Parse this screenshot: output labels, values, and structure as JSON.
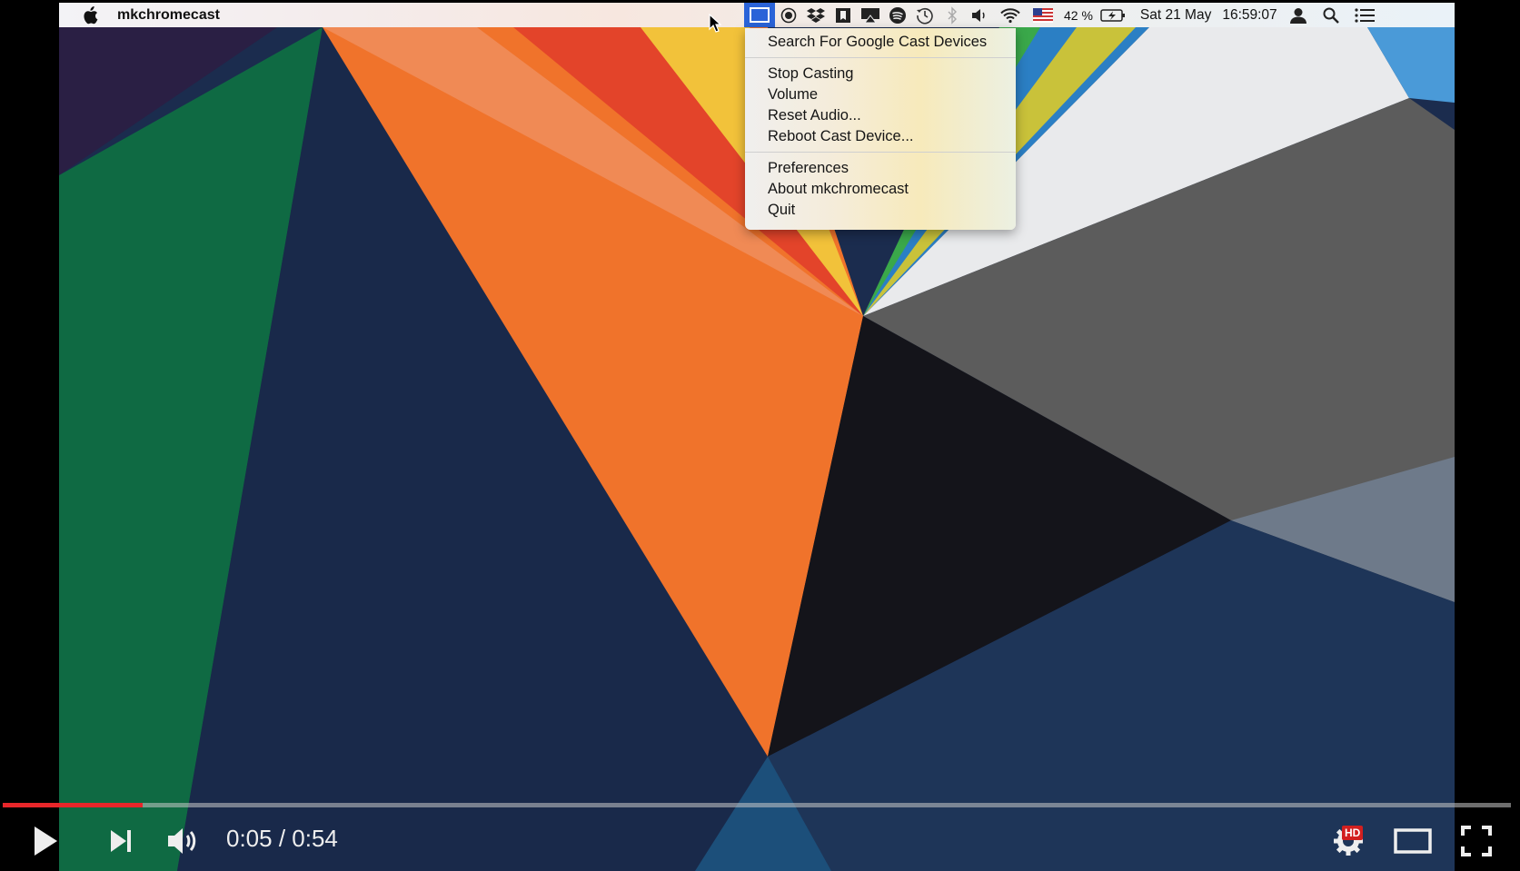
{
  "menubar": {
    "app_name": "mkchromecast",
    "battery_text": "42 %",
    "date_text": "Sat 21 May",
    "time_text": "16:59:07",
    "icons": [
      "apple-icon",
      "cast-icon",
      "record-icon",
      "dropbox-icon",
      "bookmark-icon",
      "airplay-icon",
      "spotify-icon",
      "time-machine-icon",
      "bluetooth-icon",
      "volume-icon",
      "wifi-icon",
      "us-flag-icon",
      "battery-icon",
      "user-icon",
      "search-icon",
      "notification-list-icon"
    ]
  },
  "cast_menu": {
    "items": [
      "Search For Google Cast Devices",
      "Stop Casting",
      "Volume",
      "Reset Audio...",
      "Reboot Cast Device...",
      "Preferences",
      "About mkchromecast",
      "Quit"
    ]
  },
  "player": {
    "time_current": "0:05",
    "time_total": "0:54",
    "time_display": "0:05 / 0:54",
    "progress_fraction": 0.093,
    "hd_badge": "HD",
    "accent_color": "#e8262a",
    "icons": [
      "play-icon",
      "next-icon",
      "volume-icon",
      "settings-icon",
      "theater-mode-icon",
      "fullscreen-icon"
    ]
  }
}
